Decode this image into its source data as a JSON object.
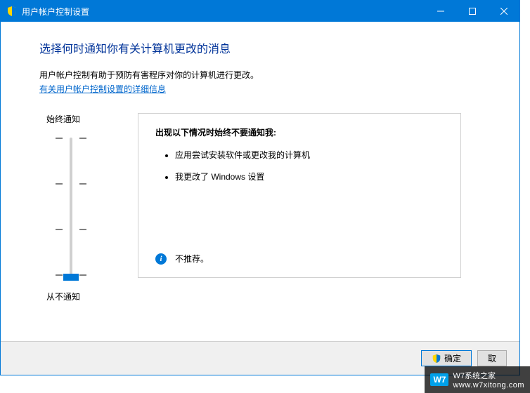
{
  "titlebar": {
    "title": "用户帐户控制设置"
  },
  "content": {
    "heading": "选择何时通知你有关计算机更改的消息",
    "description": "用户帐户控制有助于预防有害程序对你的计算机进行更改。",
    "link_text": "有关用户帐户控制设置的详细信息"
  },
  "slider": {
    "top_label": "始终通知",
    "bottom_label": "从不通知",
    "level": 0,
    "levels_count": 4
  },
  "info_box": {
    "title": "出现以下情况时始终不要通知我:",
    "items": [
      "应用尝试安装软件或更改我的计算机",
      "我更改了 Windows 设置"
    ],
    "recommendation": "不推荐。"
  },
  "footer": {
    "ok_label": "确定",
    "cancel_label": "取"
  },
  "watermark": {
    "badge": "W7",
    "text": "W7系统之家",
    "url": "www.w7xitong.com"
  }
}
